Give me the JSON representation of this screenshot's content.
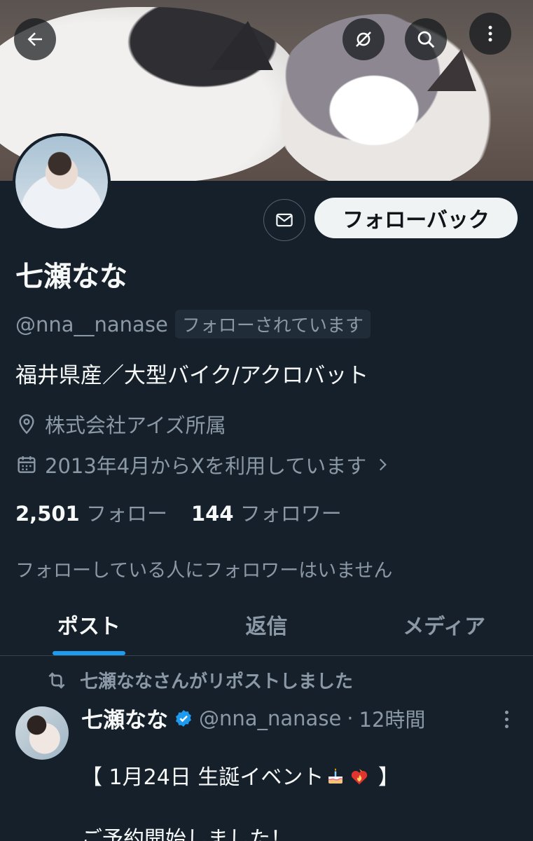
{
  "profile": {
    "display_name": "七瀬なな",
    "handle": "@nna__nanase",
    "follows_you_badge": "フォローされています",
    "bio": "福井県産／大型バイク/アクロバット",
    "affiliation": "株式会社アイズ所属",
    "joined": "2013年4月からXを利用しています",
    "following_count": "2,501",
    "following_label": "フォロー",
    "followers_count": "144",
    "followers_label": "フォロワー",
    "mutual_note": "フォローしている人にフォロワーはいません",
    "follow_back_label": "フォローバック"
  },
  "tabs": [
    {
      "label": "ポスト",
      "active": true
    },
    {
      "label": "返信",
      "active": false
    },
    {
      "label": "メディア",
      "active": false
    }
  ],
  "post": {
    "repost_label": "七瀬ななさんがリポストしました",
    "author_name": "七瀬なな",
    "author_handle": "@nna_nanase",
    "separator": "·",
    "time": "12時間",
    "text_open": "【 1月24日 生誕イベント",
    "text_close": " 】",
    "text_second": "ご予約開始しました！",
    "emoji": [
      "birthday-cake",
      "heart-on-fire"
    ]
  },
  "colors": {
    "background": "#15202b",
    "accent": "#1d9bf0",
    "secondary_text": "#8b98a5"
  }
}
